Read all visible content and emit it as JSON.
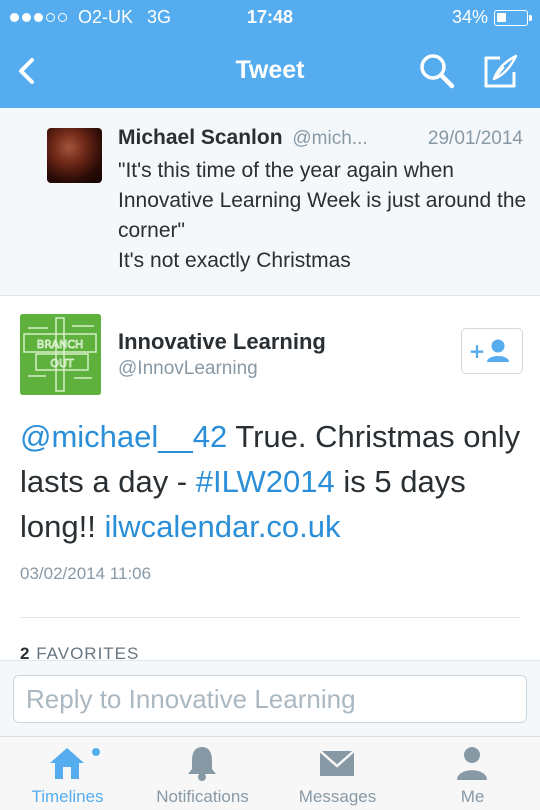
{
  "status_bar": {
    "carrier": "O2-UK",
    "network": "3G",
    "time": "17:48",
    "battery": "34%",
    "battery_level": 0.34,
    "signal_bars": 3,
    "signal_max": 5
  },
  "nav": {
    "title": "Tweet",
    "back_icon": "chevron-left-icon",
    "search_icon": "search-icon",
    "compose_icon": "compose-icon"
  },
  "parent_tweet": {
    "name": "Michael Scanlon",
    "handle": "@mich...",
    "date": "29/01/2014",
    "line1": "\"It's this time of the year again when Innovative Learning Week is just around the corner\"",
    "line2": "It's not exactly Christmas"
  },
  "main_tweet": {
    "name": "Innovative Learning",
    "handle": "@InnovLearning",
    "avatar_text": "BRANCH OUT",
    "text_mention": "@michael__42",
    "text_part1": " True. Christmas only lasts a day - ",
    "text_hashtag": "#ILW2014",
    "text_part2": " is 5 days long!! ",
    "text_link": "ilwcalendar.co.uk",
    "timestamp": "03/02/2014 11:06",
    "favorites_count": "2",
    "favorites_label": "FAVORITES"
  },
  "reply": {
    "placeholder": "Reply to Innovative Learning"
  },
  "tabs": [
    {
      "label": "Timelines",
      "icon": "home-icon",
      "active": true
    },
    {
      "label": "Notifications",
      "icon": "bell-icon",
      "active": false
    },
    {
      "label": "Messages",
      "icon": "envelope-icon",
      "active": false
    },
    {
      "label": "Me",
      "icon": "person-icon",
      "active": false
    }
  ],
  "colors": {
    "accent": "#55acee",
    "link": "#2a8fd8",
    "avatar_green": "#5db13c"
  }
}
